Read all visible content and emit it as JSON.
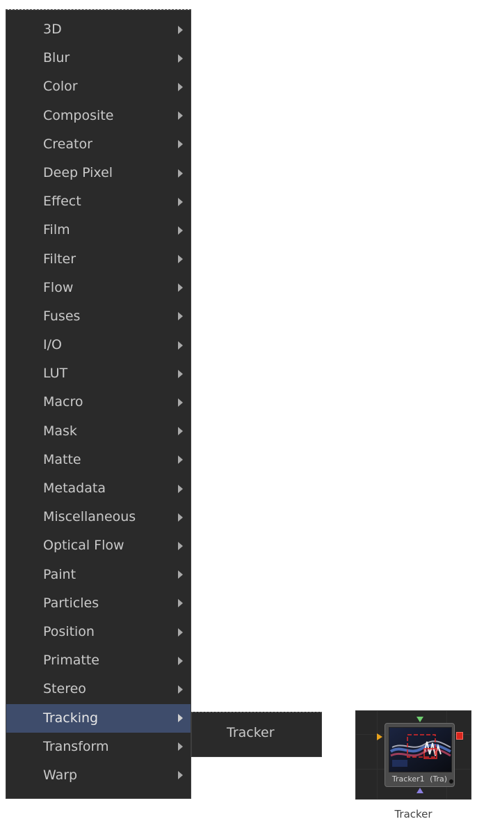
{
  "menu": {
    "items": [
      {
        "label": "3D",
        "has_submenu": true
      },
      {
        "label": "Blur",
        "has_submenu": true
      },
      {
        "label": "Color",
        "has_submenu": true
      },
      {
        "label": "Composite",
        "has_submenu": true
      },
      {
        "label": "Creator",
        "has_submenu": true
      },
      {
        "label": "Deep Pixel",
        "has_submenu": true
      },
      {
        "label": "Effect",
        "has_submenu": true
      },
      {
        "label": "Film",
        "has_submenu": true
      },
      {
        "label": "Filter",
        "has_submenu": true
      },
      {
        "label": "Flow",
        "has_submenu": true
      },
      {
        "label": "Fuses",
        "has_submenu": true
      },
      {
        "label": "I/O",
        "has_submenu": true
      },
      {
        "label": "LUT",
        "has_submenu": true
      },
      {
        "label": "Macro",
        "has_submenu": true
      },
      {
        "label": "Mask",
        "has_submenu": true
      },
      {
        "label": "Matte",
        "has_submenu": true
      },
      {
        "label": "Metadata",
        "has_submenu": true
      },
      {
        "label": "Miscellaneous",
        "has_submenu": true
      },
      {
        "label": "Optical Flow",
        "has_submenu": true
      },
      {
        "label": "Paint",
        "has_submenu": true
      },
      {
        "label": "Particles",
        "has_submenu": true
      },
      {
        "label": "Position",
        "has_submenu": true
      },
      {
        "label": "Primatte",
        "has_submenu": true
      },
      {
        "label": "Stereo",
        "has_submenu": true
      },
      {
        "label": "Tracking",
        "has_submenu": true,
        "active": true
      },
      {
        "label": "Transform",
        "has_submenu": true
      },
      {
        "label": "Warp",
        "has_submenu": true
      }
    ]
  },
  "submenu": {
    "items": [
      {
        "label": "Tracker"
      }
    ]
  },
  "node": {
    "name": "Tracker1",
    "type_abbrev": "(Tra)",
    "ports": {
      "input_background": "#e8a21c",
      "input_foreground": "#6fcf6f",
      "input_effect_mask": "#8b7fe0",
      "output": "#d9261e"
    }
  },
  "caption": "Tracker",
  "colors": {
    "menu_background": "#2a2a2a",
    "menu_text": "#c9c9c9",
    "active_highlight": "#3e4c6b",
    "node_body": "#4b4b4b"
  }
}
